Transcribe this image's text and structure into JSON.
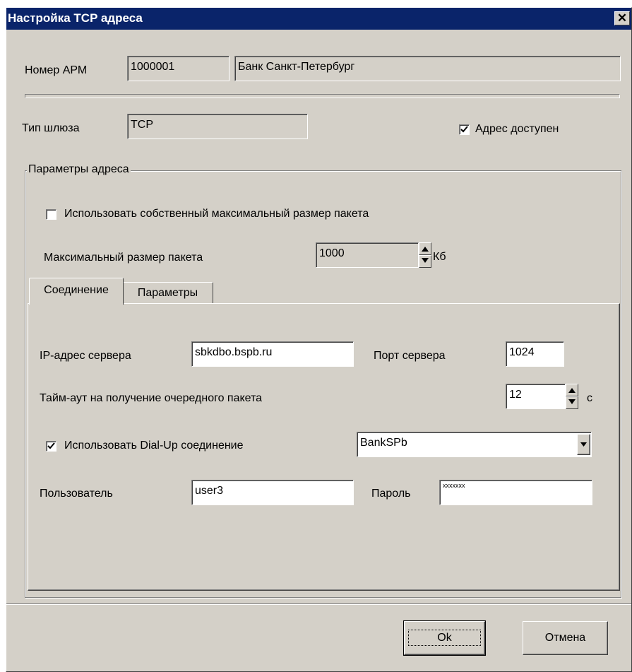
{
  "window": {
    "title": "Настройка TCP адреса",
    "close_glyph": "✕"
  },
  "arm": {
    "label": "Номер АРМ",
    "number": "1000001",
    "bank_name": "Банк Санкт-Петербург"
  },
  "gateway": {
    "label": "Тип шлюза",
    "value": "TCP",
    "available_label": "Адрес доступен",
    "available_checked": true
  },
  "params_group": {
    "title": "Параметры адреса",
    "own_packet_size_label": "Использовать собственный максимальный размер пакета",
    "own_packet_size_checked": false,
    "max_packet_label": "Максимальный размер пакета",
    "max_packet_value": "1000",
    "max_packet_unit": "Кб"
  },
  "tabs": [
    {
      "label": "Соединение",
      "active": true
    },
    {
      "label": "Параметры",
      "active": false
    }
  ],
  "connection": {
    "server_ip_label": "IP-адрес сервера",
    "server_ip_value": "sbkdbo.bspb.ru",
    "server_port_label": "Порт сервера",
    "server_port_value": "1024",
    "timeout_label": "Тайм-аут на получение очередного пакета",
    "timeout_value": "12",
    "timeout_unit": "с",
    "dialup_label": "Использовать Dial-Up соединение",
    "dialup_checked": true,
    "dialup_selected": "BankSPb",
    "user_label": "Пользователь",
    "user_value": "user3",
    "password_label": "Пароль",
    "password_value": "xxxxxxx"
  },
  "buttons": {
    "ok": "Ok",
    "cancel": "Отмена"
  },
  "colors": {
    "titlebar": "#0a246a",
    "face": "#d4d0c8"
  }
}
